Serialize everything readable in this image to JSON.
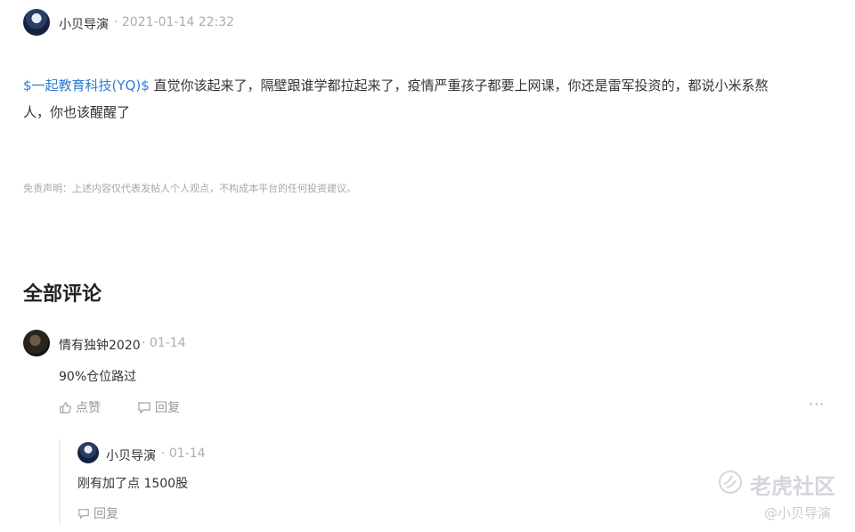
{
  "post": {
    "author": "小贝导演",
    "time": "· 2021-01-14 22:32",
    "stock_tag": "$一起教育科技(YQ)$",
    "body_line1": " 直觉你该起来了，隔壁跟谁学都拉起来了，疫情严重孩子都要上网课，你还是雷军投资的，都说小米系熬",
    "body_line2": "人，你也该醒醒了",
    "disclaimer": "免责声明：上述内容仅代表发帖人个人观点，不构成本平台的任何投资建议。"
  },
  "comments_section": {
    "title": "全部评论",
    "comment": {
      "author": "情有独钟2020",
      "time": "· 01-14",
      "text": "90%仓位路过",
      "like_label": "点赞",
      "reply_label": "回复",
      "more_label": "···",
      "reply": {
        "author": "小贝导演",
        "time": "· 01-14",
        "text": "刚有加了点 1500股",
        "reply_label": "回复"
      }
    }
  },
  "watermark": {
    "brand": "老虎社区",
    "user": "@小贝导演"
  },
  "colors": {
    "link": "#2f7ad6",
    "meta": "#a8adb5",
    "text": "#333333"
  }
}
